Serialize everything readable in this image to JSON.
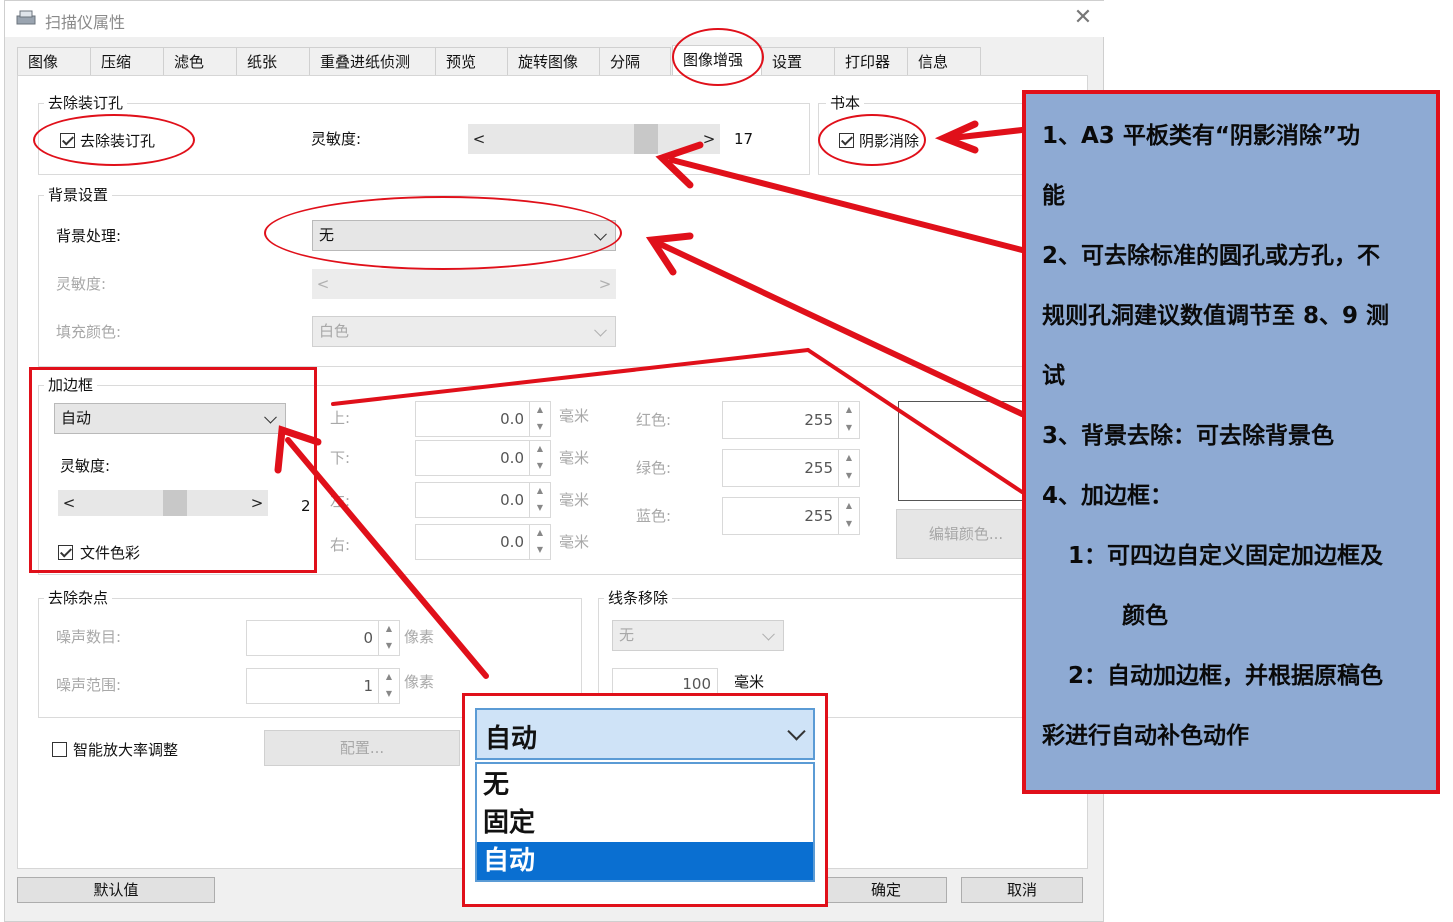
{
  "dialog": {
    "title": "扫描仪属性",
    "close": "✕",
    "tabs": [
      "图像",
      "压缩",
      "滤色",
      "纸张",
      "重叠进纸侦测",
      "预览",
      "旋转图像",
      "分隔",
      "图像增强",
      "设置",
      "打印器",
      "信息"
    ],
    "active_tab": "图像增强"
  },
  "hole_removal": {
    "group": "去除装订孔",
    "checkbox": "去除装订孔",
    "checked": true,
    "sensitivity_label": "灵敏度:",
    "sensitivity_value": "17"
  },
  "book": {
    "group": "书本",
    "checkbox": "阴影消除",
    "checked": true
  },
  "background": {
    "group": "背景设置",
    "processing_label": "背景处理:",
    "processing_value": "无",
    "sensitivity_label": "灵敏度:",
    "fill_color_label": "填充颜色:",
    "fill_color_value": "白色"
  },
  "border": {
    "group": "加边框",
    "mode": "自动",
    "sensitivity_label": "灵敏度:",
    "sensitivity_value": "2",
    "doc_color_checkbox": "文件色彩",
    "doc_color_checked": true,
    "top_label": "上:",
    "bottom_label": "下:",
    "left_label": "左:",
    "right_label": "右:",
    "top": "0.0",
    "bottom": "0.0",
    "left": "0.0",
    "right": "0.0",
    "unit": "毫米",
    "red_label": "红色:",
    "green_label": "绿色:",
    "blue_label": "蓝色:",
    "red": "255",
    "green": "255",
    "blue": "255",
    "edit_color": "编辑颜色..."
  },
  "noise": {
    "group": "去除杂点",
    "count_label": "噪声数目:",
    "count": "0",
    "range_label": "噪声范围:",
    "range": "1",
    "unit": "像素"
  },
  "line_removal": {
    "group": "线条移除",
    "mode": "无",
    "value": "100",
    "unit": "毫米"
  },
  "smart_zoom": {
    "checkbox": "智能放大率调整",
    "checked": false,
    "config": "配置..."
  },
  "buttons": {
    "default": "默认值",
    "ok": "确定",
    "cancel": "取消"
  },
  "dropdown_popup": {
    "selected": "自动",
    "options": [
      "无",
      "固定",
      "自动"
    ],
    "highlighted": "自动"
  },
  "annotation": {
    "lines": [
      "1、A3 平板类有“阴影消除”功",
      "能",
      "2、可去除标准的圆孔或方孔，不",
      "规则孔洞建议数值调节至 8、9 测",
      "试",
      "3、背景去除：可去除背景色",
      "4、加边框：",
      "1：可四边自定义固定加边框及",
      "颜色",
      "2：自动加边框，并根据原稿色",
      "彩进行自动补色动作"
    ]
  },
  "colors": {
    "accent_red": "#e0101a",
    "note_bg": "#8eaad3",
    "highlight": "#0a6fd1"
  }
}
